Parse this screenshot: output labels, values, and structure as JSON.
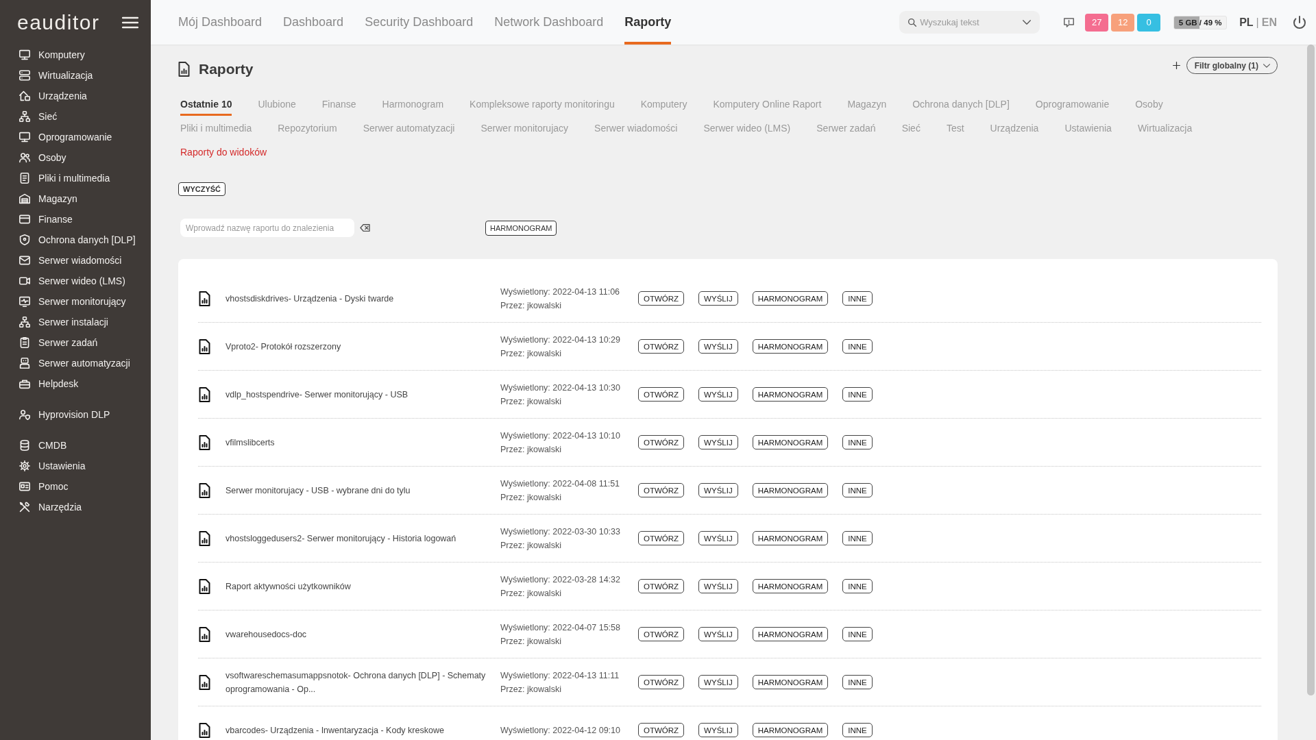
{
  "sidebar": {
    "logo": "eauditor",
    "groups": [
      {
        "items": [
          {
            "label": "Komputery"
          },
          {
            "label": "Wirtualizacja"
          },
          {
            "label": "Urządzenia"
          },
          {
            "label": "Sieć"
          },
          {
            "label": "Oprogramowanie"
          },
          {
            "label": "Osoby"
          },
          {
            "label": "Pliki i multimedia"
          },
          {
            "label": "Magazyn"
          },
          {
            "label": "Finanse"
          },
          {
            "label": "Ochrona danych [DLP]"
          },
          {
            "label": "Serwer wiadomości"
          },
          {
            "label": "Serwer wideo (LMS)"
          },
          {
            "label": "Serwer monitorujący"
          },
          {
            "label": "Serwer instalacji"
          },
          {
            "label": "Serwer zadań"
          },
          {
            "label": "Serwer automatyzacji"
          },
          {
            "label": "Helpdesk"
          }
        ]
      },
      {
        "items": [
          {
            "label": "Hyprovision DLP"
          }
        ]
      },
      {
        "items": [
          {
            "label": "CMDB"
          },
          {
            "label": "Ustawienia"
          },
          {
            "label": "Pomoc"
          },
          {
            "label": "Narzędzia"
          }
        ]
      }
    ]
  },
  "top_nav": {
    "tabs": [
      {
        "label": "Mój Dashboard",
        "selected": false
      },
      {
        "label": "Dashboard",
        "selected": false
      },
      {
        "label": "Security Dashboard",
        "selected": false
      },
      {
        "label": "Network Dashboard",
        "selected": false
      },
      {
        "label": "Raporty",
        "selected": true
      }
    ],
    "search": {
      "placeholder": "Wyszukaj tekst"
    },
    "alert_badges": [
      {
        "count": "27",
        "color": "#f46d90"
      },
      {
        "count": "12",
        "color": "#f7a07b"
      },
      {
        "count": "0",
        "color": "#36bfe2"
      }
    ],
    "storage": {
      "reading": "5 GB / 49 %",
      "level": 0.49
    },
    "languages": [
      {
        "label": "PL",
        "selected": true
      },
      {
        "label": "EN",
        "selected": false
      }
    ],
    "language_separator": "|"
  },
  "page": {
    "title": "Raporty",
    "filter_button": "Filtr globalny (1)"
  },
  "category_tabs": [
    {
      "label": "Ostatnie 10",
      "kind": "tab",
      "selected": true
    },
    {
      "label": "Ulubione",
      "kind": "tab",
      "selected": false
    },
    {
      "label": "Finanse",
      "kind": "tab",
      "selected": false
    },
    {
      "label": "Harmonogram",
      "kind": "tab",
      "selected": false
    },
    {
      "label": "Kompleksowe raporty monitoringu",
      "kind": "tab",
      "selected": false
    },
    {
      "label": "Komputery",
      "kind": "tab",
      "selected": false
    },
    {
      "label": "Komputery Online Raport",
      "kind": "tab",
      "selected": false
    },
    {
      "label": "Magazyn",
      "kind": "tab",
      "selected": false
    },
    {
      "label": "Ochrona danych [DLP]",
      "kind": "tab",
      "selected": false
    },
    {
      "label": "Oprogramowanie",
      "kind": "tab",
      "selected": false
    },
    {
      "label": "Osoby",
      "kind": "tab",
      "selected": false
    },
    {
      "label": "Pliki i multimedia",
      "kind": "tab",
      "selected": false
    },
    {
      "label": "Repozytorium",
      "kind": "tab",
      "selected": false
    },
    {
      "label": "Serwer automatyzacji",
      "kind": "tab",
      "selected": false
    },
    {
      "label": "Serwer monitorujacy",
      "kind": "tab",
      "selected": false
    },
    {
      "label": "Serwer wiadomości",
      "kind": "tab",
      "selected": false
    },
    {
      "label": "Serwer wideo (LMS)",
      "kind": "tab",
      "selected": false
    },
    {
      "label": "Serwer zadań",
      "kind": "tab",
      "selected": false
    },
    {
      "label": "Sieć",
      "kind": "tab",
      "selected": false
    },
    {
      "label": "Test",
      "kind": "tab",
      "selected": false
    },
    {
      "label": "Urządzenia",
      "kind": "tab",
      "selected": false
    },
    {
      "label": "Ustawienia",
      "kind": "tab",
      "selected": false
    },
    {
      "label": "Wirtualizacja",
      "kind": "tab",
      "selected": false
    },
    {
      "label": "Raporty do widoków",
      "kind": "highlight",
      "selected": false
    }
  ],
  "clear_button": "WYCZYŚĆ",
  "report_search": {
    "placeholder": "Wprowadź nazwę raportu do znalezienia"
  },
  "schedule_button": "HARMONOGRAM",
  "reports": [
    {
      "name": "vhostsdiskdrives- Urządzenia - Dyski twarde",
      "viewed": "Wyświetlony: 2022-04-13 11:06",
      "by": "Przez: jkowalski",
      "actions": [
        "OTWÓRZ",
        "WYŚLIJ",
        "HARMONOGRAM",
        "INNE"
      ]
    },
    {
      "name": "Vproto2- Protokół rozszerzony",
      "viewed": "Wyświetlony: 2022-04-13 10:29",
      "by": "Przez: jkowalski",
      "actions": [
        "OTWÓRZ",
        "WYŚLIJ",
        "HARMONOGRAM",
        "INNE"
      ]
    },
    {
      "name": "vdlp_hostspendrive- Serwer monitorujący - USB",
      "viewed": "Wyświetlony: 2022-04-13 10:30",
      "by": "Przez: jkowalski",
      "actions": [
        "OTWÓRZ",
        "WYŚLIJ",
        "HARMONOGRAM",
        "INNE"
      ]
    },
    {
      "name": "vfilmslibcerts",
      "viewed": "Wyświetlony: 2022-04-13 10:10",
      "by": "Przez: jkowalski",
      "actions": [
        "OTWÓRZ",
        "WYŚLIJ",
        "HARMONOGRAM",
        "INNE"
      ]
    },
    {
      "name": "Serwer monitorujacy - USB - wybrane dni do tylu",
      "viewed": "Wyświetlony: 2022-04-08 11:51",
      "by": "Przez: jkowalski",
      "actions": [
        "OTWÓRZ",
        "WYŚLIJ",
        "HARMONOGRAM",
        "INNE"
      ]
    },
    {
      "name": "vhostsloggedusers2- Serwer monitorujący - Historia logowań",
      "viewed": "Wyświetlony: 2022-03-30 10:33",
      "by": "Przez: jkowalski",
      "actions": [
        "OTWÓRZ",
        "WYŚLIJ",
        "HARMONOGRAM",
        "INNE"
      ]
    },
    {
      "name": "Raport aktywności użytkowników",
      "viewed": "Wyświetlony: 2022-03-28 14:32",
      "by": "Przez: jkowalski",
      "actions": [
        "OTWÓRZ",
        "WYŚLIJ",
        "HARMONOGRAM",
        "INNE"
      ]
    },
    {
      "name": "vwarehousedocs-doc",
      "viewed": "Wyświetlony: 2022-04-07 15:58",
      "by": "Przez: jkowalski",
      "actions": [
        "OTWÓRZ",
        "WYŚLIJ",
        "HARMONOGRAM",
        "INNE"
      ]
    },
    {
      "name": "vsoftwareschemasumappsnotok- Ochrona danych [DLP] - Schematy oprogramowania - Op...",
      "viewed": "Wyświetlony: 2022-04-13 11:11",
      "by": "Przez: jkowalski",
      "actions": [
        "OTWÓRZ",
        "WYŚLIJ",
        "HARMONOGRAM",
        "INNE"
      ]
    },
    {
      "name": "vbarcodes- Urządzenia - Inwentaryzacja - Kody kreskowe",
      "viewed": "Wyświetlony: 2022-04-12 09:10",
      "actions": [
        "OTWÓRZ",
        "WYŚLIJ",
        "HARMONOGRAM",
        "INNE"
      ]
    }
  ]
}
